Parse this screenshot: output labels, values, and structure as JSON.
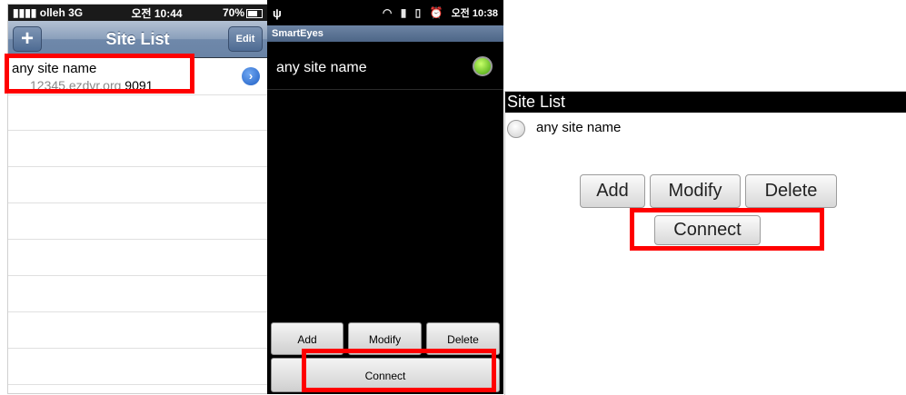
{
  "ios": {
    "status": {
      "carrier": "olleh 3G",
      "time": "오전 10:44",
      "battery": "70%"
    },
    "nav": {
      "add_label": "+",
      "title": "Site List",
      "edit_label": "Edit"
    },
    "row": {
      "name": "any site name",
      "host": "12345.ezdvr.org",
      "port": "9091",
      "disclosure_icon": "chevron-right-circle-icon"
    }
  },
  "android": {
    "status": {
      "usb_icon": "ψ",
      "icons": "wifi signal battery alarm",
      "time": "오전 10:38"
    },
    "app_title": "SmartEyes",
    "row": {
      "name": "any site name",
      "status_color": "#3fa00a"
    },
    "buttons": {
      "add": "Add",
      "modify": "Modify",
      "delete": "Delete",
      "connect": "Connect"
    }
  },
  "right_panel": {
    "title": "Site List",
    "row": {
      "name": "any site name"
    },
    "buttons": {
      "add": "Add",
      "modify": "Modify",
      "delete": "Delete",
      "connect": "Connect"
    }
  },
  "highlight_color": "#ff0000"
}
